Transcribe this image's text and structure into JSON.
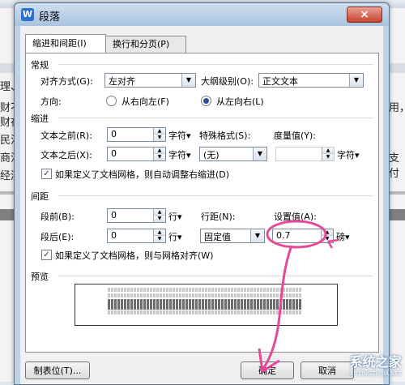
{
  "dialog": {
    "title": "段落",
    "close_label": "×",
    "app_icon_label": "W"
  },
  "tabs": [
    {
      "label": "缩进和间距(I)",
      "active": true
    },
    {
      "label": "换行和分页(P)",
      "active": false
    }
  ],
  "general": {
    "heading": "常规",
    "align_label": "对齐方式(G):",
    "align_value": "左对齐",
    "outline_label": "大纲级别(O):",
    "outline_value": "正文文本",
    "direction_label": "方向:",
    "rtl_label": "从右向左(F)",
    "ltr_label": "从左向右(L)",
    "selected_direction": "ltr"
  },
  "indent": {
    "heading": "缩进",
    "before_label": "文本之前(R):",
    "before_value": "0",
    "before_unit": "字符▾",
    "after_label": "文本之后(X):",
    "after_value": "0",
    "after_unit": "字符▾",
    "special_label": "特殊格式(S):",
    "special_value": "(无)",
    "measure_label": "度量值(Y):",
    "measure_value": "",
    "measure_unit": "字符▾",
    "auto_adjust_label": "如果定义了文档网格，则自动调整右缩进(D)",
    "auto_adjust_checked": true
  },
  "spacing": {
    "heading": "间距",
    "before_label": "段前(B):",
    "before_value": "0",
    "before_unit": "行▾",
    "after_label": "段后(E):",
    "after_value": "0",
    "after_unit": "行▾",
    "line_label": "行距(N):",
    "line_value": "固定值",
    "setting_label": "设置值(A):",
    "setting_value": "0.7",
    "setting_unit": "磅▾",
    "grid_align_label": "如果定义了文档网格，则与网格对齐(W)",
    "grid_align_checked": true
  },
  "preview": {
    "heading": "预览"
  },
  "buttons": {
    "tabs_label": "制表位(T)...",
    "ok_label": "确定",
    "cancel_label": "取消"
  },
  "background": {
    "left_lines": [
      "理、",
      "财不",
      "财在",
      "民法",
      "商法",
      "经济"
    ],
    "right_lines": [
      "用，",
      "支付"
    ]
  },
  "watermark": {
    "name": "系统之家",
    "url": "XITONGZHIJIA.NET"
  },
  "colors": {
    "annotation_pen": "#e8489a",
    "titlebar": "#bcd3ea"
  }
}
